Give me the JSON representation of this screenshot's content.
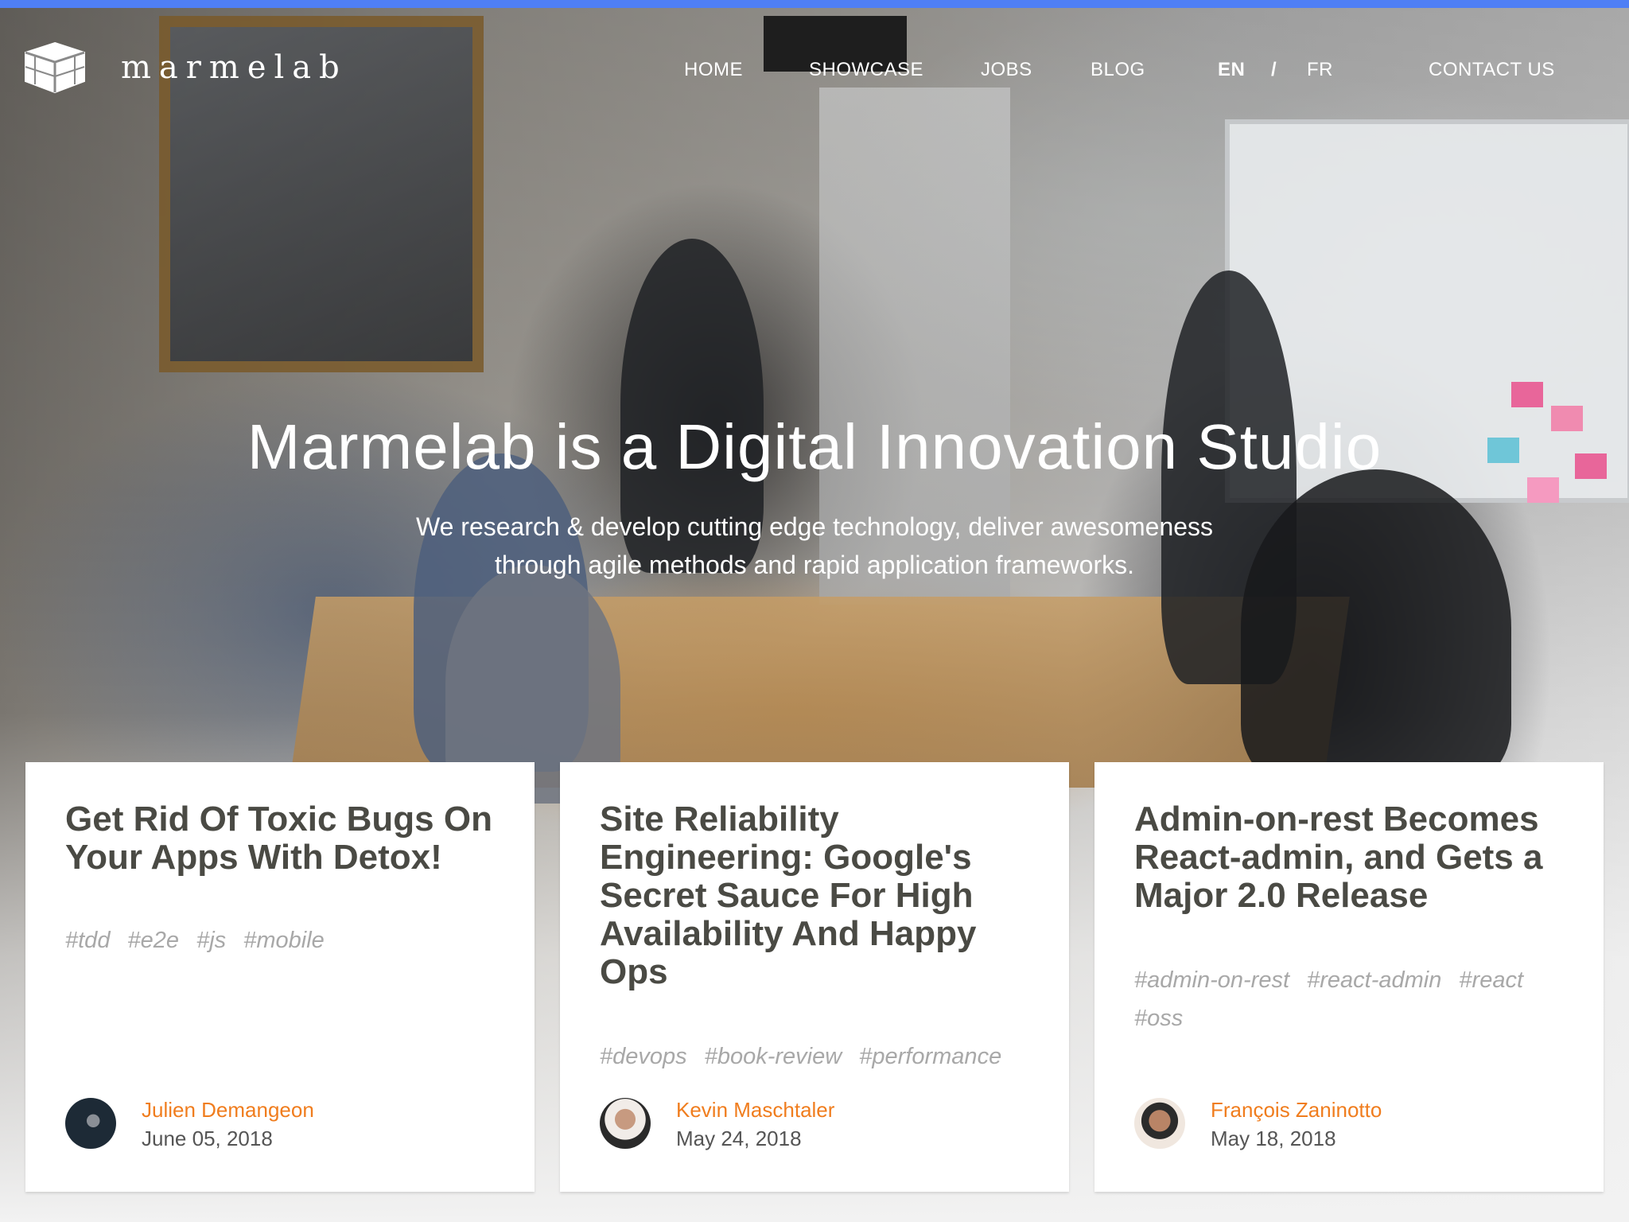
{
  "brand": {
    "name": "marmelab"
  },
  "nav": {
    "home": "HOME",
    "showcase": "SHOWCASE",
    "jobs": "JOBS",
    "blog": "BLOG",
    "lang_en": "EN",
    "lang_sep": "/",
    "lang_fr": "FR",
    "contact": "CONTACT US"
  },
  "hero": {
    "title": "Marmelab is a Digital Innovation Studio",
    "subtitle_line1": "We research & develop cutting edge technology, deliver awesomeness",
    "subtitle_line2": "through agile methods and rapid application frameworks."
  },
  "posts": [
    {
      "title": "Get Rid Of Toxic Bugs On Your Apps With Detox!",
      "tags": [
        "#tdd",
        "#e2e",
        "#js",
        "#mobile"
      ],
      "author": "Julien Demangeon",
      "date": "June 05, 2018"
    },
    {
      "title": "Site Reliability Engineering: Google's Secret Sauce For High Availability And Happy Ops",
      "tags": [
        "#devops",
        "#book-review",
        "#performance"
      ],
      "author": "Kevin Maschtaler",
      "date": "May 24, 2018"
    },
    {
      "title": "Admin-on-rest Becomes React-admin, and Gets a Major 2.0 Release",
      "tags": [
        "#admin-on-rest",
        "#react-admin",
        "#react",
        "#oss"
      ],
      "author": "François Zaninotto",
      "date": "May 18, 2018"
    }
  ],
  "colors": {
    "accent_bar": "#4f7ff5",
    "author_link": "#f07d1e",
    "title_text": "#4a4a44",
    "tag_text": "#a8a8a8"
  }
}
